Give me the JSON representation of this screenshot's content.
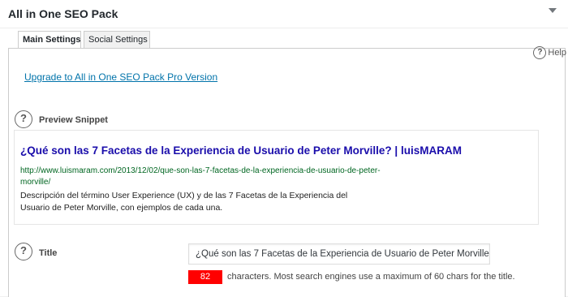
{
  "panel": {
    "title": "All in One SEO Pack",
    "toggle_icon": "triangle-down-icon"
  },
  "tabs": [
    {
      "label": "Main Settings",
      "active": true
    },
    {
      "label": "Social Settings",
      "active": false
    }
  ],
  "help": {
    "icon": "question-circle-icon",
    "label": "Help"
  },
  "upgrade_link": "Upgrade to All in One SEO Pack Pro Version",
  "preview": {
    "label": "Preview Snippet",
    "icon": "question-circle-icon",
    "title": "¿Qué son las 7 Facetas de la Experiencia de Usuario de Peter Morville? | luisMARAM",
    "url": "http://www.luismaram.com/2013/12/02/que-son-las-7-facetas-de-la-experiencia-de-usuario-de-peter-morville/",
    "description": "Descripción del término User Experience (UX) y de las 7 Facetas de la Experiencia del Usuario de Peter Morville, con ejemplos de cada una."
  },
  "title_field": {
    "label": "Title",
    "icon": "question-circle-icon",
    "value": "¿Qué son las 7 Facetas de la Experiencia de Usuario de Peter Morville?",
    "char_count": "82",
    "char_count_color": "#ff0000",
    "hint": "characters. Most search engines use a maximum of 60 chars for the title."
  },
  "colors": {
    "link": "#0073aa",
    "snippet_title": "#1a0dab",
    "snippet_url": "#006621"
  }
}
